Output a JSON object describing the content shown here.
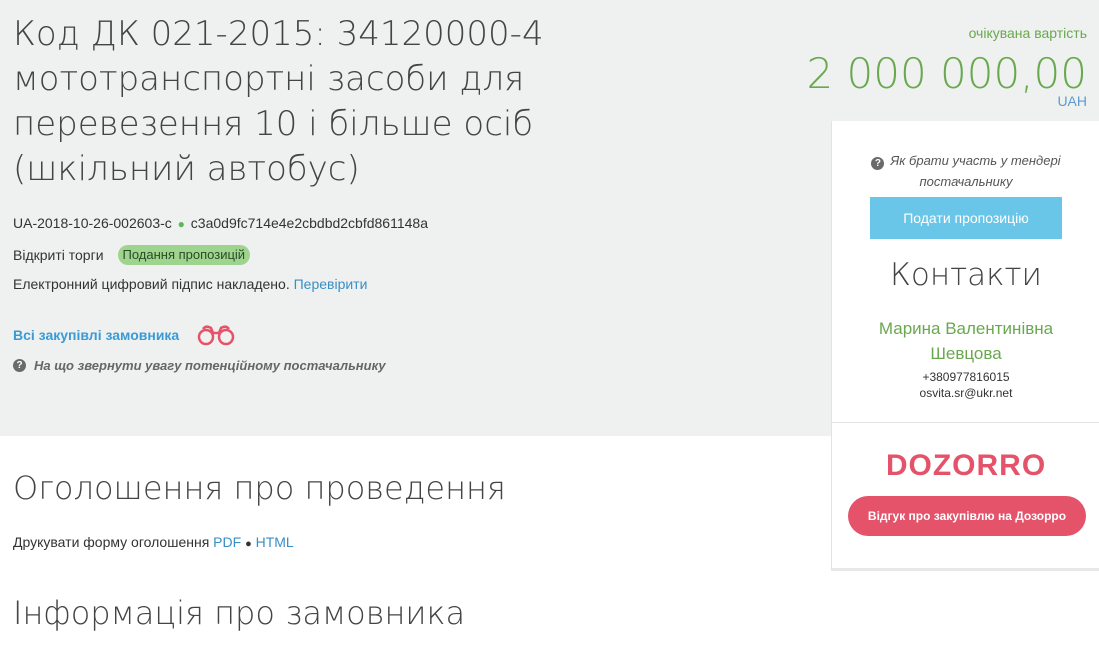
{
  "tender": {
    "title": "Код ДК 021-2015: 34120000-4 мототранспортні засоби для перевезення 10 і більше осіб (шкільний автобус)",
    "id": "UA-2018-10-26-002603-c",
    "hash": "c3a0d9fc714e4e2cbdbd2cbfd861148a",
    "procedure_type": "Відкриті торги",
    "status": "Подання пропозицій",
    "signature_text": "Електронний цифровий підпис накладено.",
    "signature_check_link": "Перевірити",
    "all_purchases_link": "Всі закупівлі замовника",
    "attention_text": "На що звернути увагу потенційному постачальнику"
  },
  "price": {
    "label": "очікувана вартість",
    "value": "2 000 000,00",
    "currency": "UAH"
  },
  "sidebar": {
    "how_to_text": "Як брати участь у тендері постачальнику",
    "submit_button": "Подати пропозицію",
    "contacts_title": "Контакти",
    "contact_name": "Марина Валентинівна Шевцова",
    "contact_phone": "+380977816015",
    "contact_email": "osvita.sr@ukr.net",
    "dozorro_logo_text": "DOZORRO",
    "feedback_button": "Відгук про закупівлю на Дозорро"
  },
  "sections": {
    "announcement_title": "Оголошення про проведення",
    "print_label": "Друкувати форму оголошення",
    "print_pdf": "PDF",
    "print_separator": "●",
    "print_html": "HTML",
    "customer_title": "Інформація про замовника"
  },
  "colors": {
    "hero_bg": "#eef1ef",
    "accent_green": "#6aa84f",
    "link_blue": "#3a8ec6",
    "submit_blue": "#6ac6e8",
    "dozorro_red": "#e5536b",
    "status_green": "#9fd48e"
  },
  "icons": {
    "question": "question-circle-icon",
    "binoculars": "binoculars-icon",
    "status_dot": "status-dot-icon"
  }
}
